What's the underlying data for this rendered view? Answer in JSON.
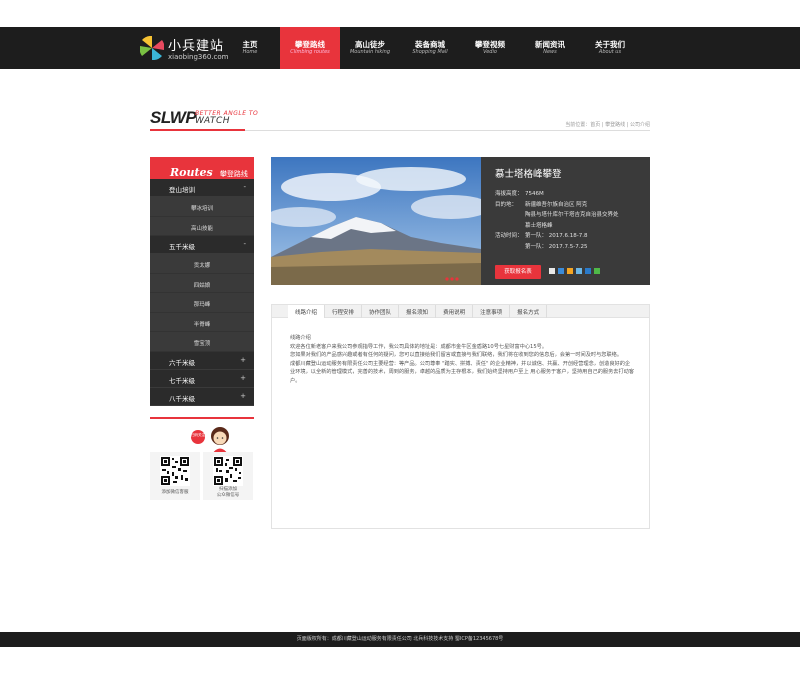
{
  "header": {
    "logo_title": "小兵建站",
    "logo_sub": "xiaobing360.com",
    "nav": [
      {
        "cn": "主页",
        "en": "Home"
      },
      {
        "cn": "攀登路线",
        "en": "Climbing routes"
      },
      {
        "cn": "高山徒步",
        "en": "Mountain hiking"
      },
      {
        "cn": "装备商城",
        "en": "Shopping Mall"
      },
      {
        "cn": "攀登视频",
        "en": "Vedio"
      },
      {
        "cn": "新闻资讯",
        "en": "News"
      },
      {
        "cn": "关于我们",
        "en": "About us"
      }
    ]
  },
  "section": {
    "title": "SLWP",
    "tag1": "BETTER ANGLE TO",
    "tag2": "WATCH",
    "breadcrumb": "当前位置：首页 | 攀登路线 | 公司介绍"
  },
  "sidebar": {
    "head_en": "Routes",
    "head_cn": "攀登路线",
    "groups": [
      {
        "label": "登山培训",
        "sign": "-",
        "subs": [
          "攀冰培训",
          "高山技能"
        ]
      },
      {
        "label": "五千米级",
        "sign": "-",
        "subs": [
          "贡太娜",
          "四姑娘",
          "那玛峰",
          "半脊峰",
          "雪宝顶"
        ]
      },
      {
        "label": "六千米级",
        "sign": "+",
        "subs": []
      },
      {
        "label": "七千米级",
        "sign": "+",
        "subs": []
      },
      {
        "label": "八千米级",
        "sign": "+",
        "subs": []
      }
    ],
    "mascot_text": "扫码关注",
    "qr": [
      {
        "label": "添加微信客服"
      },
      {
        "label1": "扫描添加",
        "label2": "公众微信号"
      }
    ]
  },
  "detail": {
    "title": "慕士塔格峰攀登",
    "altitude_label": "海拔高度：",
    "altitude_value": "7546M",
    "destination_label": "目的地：",
    "destination_value1": "新疆维吾尔族自治区 阿克",
    "destination_value2": "陶县与塔什库尔干塔吉克自治县交界处",
    "destination_value3": "慕士塔格峰",
    "time_label": "活动时间：",
    "time_value1": "第一队：  2017.6.18-7.8",
    "time_value2": "第一队：  2017.7.5-7.25",
    "signup_button": "获取报名表"
  },
  "tabs": [
    "线路介绍",
    "行程安排",
    "协作团队",
    "报名须知",
    "费用说明",
    "注意事项",
    "报名方式"
  ],
  "content": {
    "heading": "线路介绍",
    "p1": "欢迎各位新老客户来我公司参观指导工作，我公司具体的地址是：成都市金牛区金盾路10号七星财富中心15号。",
    "p2": "您如果对我们的产品感兴趣或者有任何的疑问，您可以直接给我们留言或直接与我们联络，我们将在收到您的信息后，会第一时间及时与您联络。",
    "p3": "成都川藏登山运动服务有限责任公司主要经营：等产品。公司尊奉 \"踏实、拼搏、责任\" 的企业精神，并以诚信、共赢、开创经营理念，创造良好的企业环境，以全新的管理模式，完善的技术，周到的服务，卓越的品质为主存根本，我们始终坚持用户至上 用心服务于客户，坚持用自己的服务去打动客户。"
  },
  "footer": {
    "text": "页面版权所有：成都川藏登山运动服务有限责任公司  北兵科技技术支持  蜀ICP备12345678号"
  },
  "colors": {
    "accent": "#e8343c",
    "dark": "#1d1d1d"
  }
}
